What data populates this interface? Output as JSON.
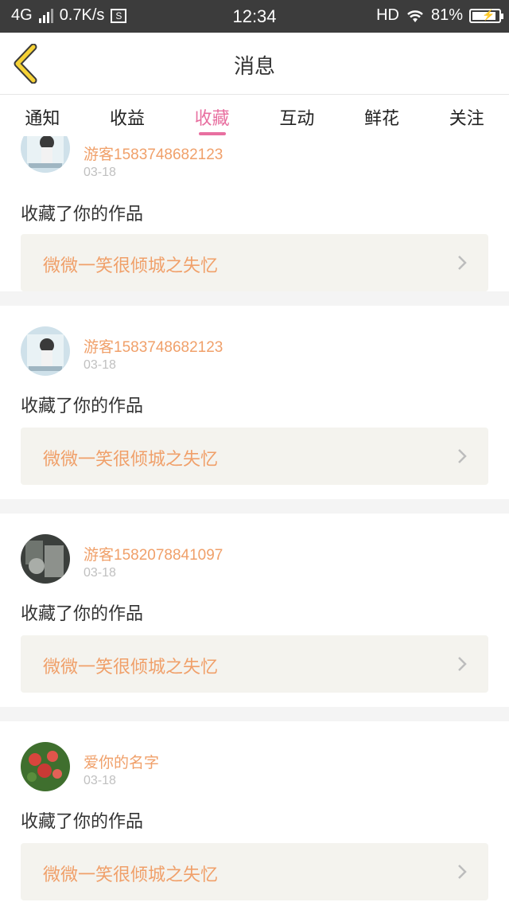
{
  "status_bar": {
    "network": "4G",
    "speed": "0.7K/s",
    "time": "12:34",
    "hd": "HD",
    "battery": "81%"
  },
  "nav": {
    "title": "消息"
  },
  "tabs": [
    "通知",
    "收益",
    "收藏",
    "互动",
    "鲜花",
    "关注"
  ],
  "active_tab": 2,
  "colors": {
    "accent": "#e86fa0",
    "orange": "#f0a06a",
    "workbox": "#f4f3ee"
  },
  "messages": [
    {
      "user": "游客1583748682123",
      "date": "03-18",
      "action": "收藏了你的作品",
      "work": "微微一笑很倾城之失忆",
      "avatar": "girl-photo-avatar"
    },
    {
      "user": "游客1583748682123",
      "date": "03-18",
      "action": "收藏了你的作品",
      "work": "微微一笑很倾城之失忆",
      "avatar": "girl-photo-avatar"
    },
    {
      "user": "游客1582078841097",
      "date": "03-18",
      "action": "收藏了你的作品",
      "work": "微微一笑很倾城之失忆",
      "avatar": "dark-photo-avatar"
    },
    {
      "user": "爱你的名字",
      "date": "03-18",
      "action": "收藏了你的作品",
      "work": "微微一笑很倾城之失忆",
      "avatar": "flower-photo-avatar"
    }
  ]
}
